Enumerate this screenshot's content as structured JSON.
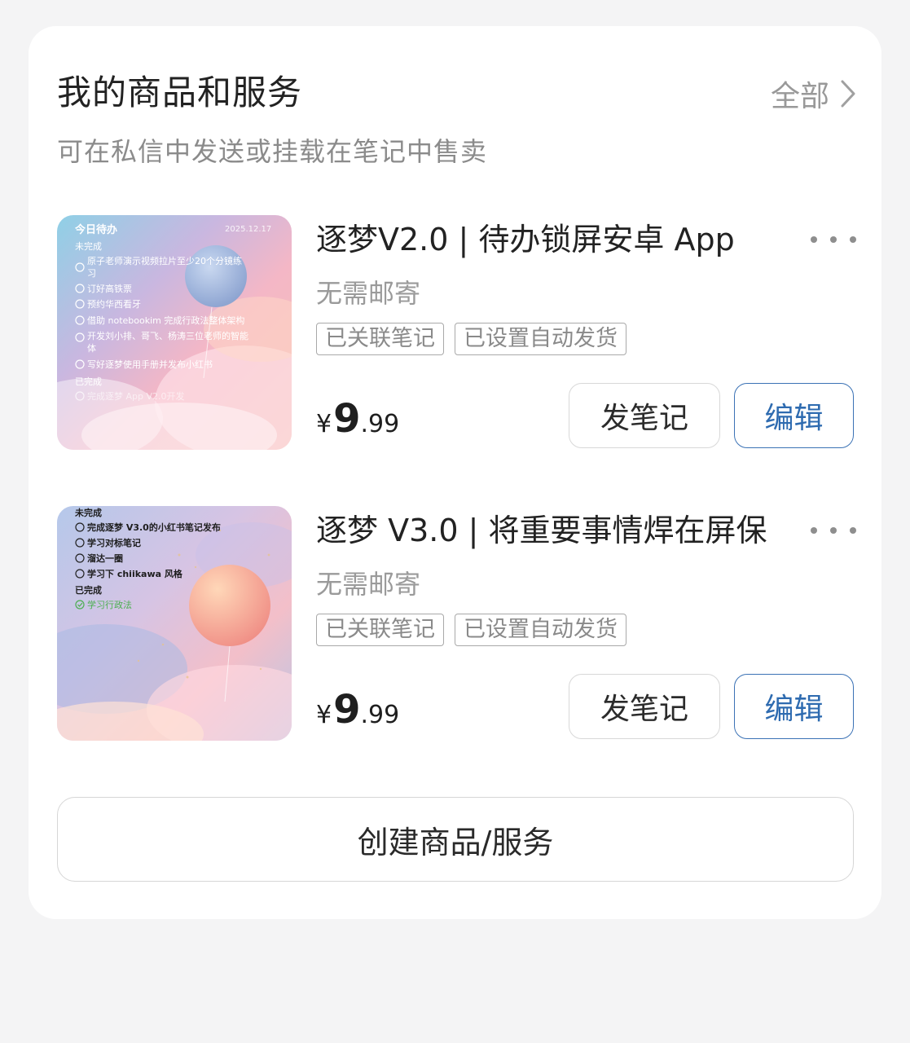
{
  "section": {
    "title": "我的商品和服务",
    "all_label": "全部",
    "subtitle": "可在私信中发送或挂载在笔记中售卖"
  },
  "products": [
    {
      "title": "逐梦V2.0 | 待办锁屏安卓 App",
      "shipping": "无需邮寄",
      "tags": [
        "已关联笔记",
        "已设置自动发货"
      ],
      "price_currency": "¥",
      "price_int": "9",
      "price_dec": ".99",
      "note_button": "发笔记",
      "edit_button": "编辑",
      "thumbnail": {
        "header": "今日待办",
        "date": "2025.12.17",
        "pending_label": "未完成",
        "pending": [
          "原子老师演示视频拉片至少20个分镜练",
          "习",
          "订好高铁票",
          "预约华西看牙",
          "借助 notebookim 完成行政法整体架构",
          "开发刘小排、哥飞、杨涛三位老师的智能",
          "体",
          "写好逐梦使用手册并发布小红书"
        ],
        "done_label": "已完成",
        "done": [
          "完成逐梦 App V2.0开发"
        ]
      }
    },
    {
      "title": "逐梦 V3.0 | 将重要事情焊在屏保",
      "shipping": "无需邮寄",
      "tags": [
        "已关联笔记",
        "已设置自动发货"
      ],
      "price_currency": "¥",
      "price_int": "9",
      "price_dec": ".99",
      "note_button": "发笔记",
      "edit_button": "编辑",
      "thumbnail": {
        "pending_label": "未完成",
        "pending": [
          "完成逐梦 V3.0的小红书笔记发布",
          "学习对标笔记",
          "溜达一圈",
          "学习下 chiikawa 风格"
        ],
        "done_label": "已完成",
        "done": [
          "学习行政法"
        ]
      }
    }
  ],
  "create_button": "创建商品/服务",
  "colors": {
    "background": "#f4f4f5",
    "card": "#ffffff",
    "accent": "#2e6bb0",
    "secondary_text": "#999999"
  },
  "icons": {
    "all_arrow": "chevron-right-icon",
    "more": "more-dots-icon",
    "checkbox": "circle-checkbox-icon",
    "done": "check-circle-icon"
  }
}
